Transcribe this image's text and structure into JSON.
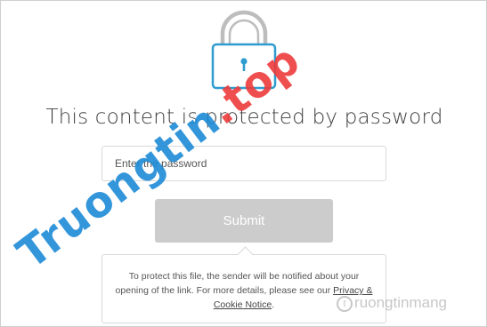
{
  "lock": {
    "icon": "padlock-icon",
    "shackle_color": "#bdbdbd",
    "body_color": "#2f9ccf"
  },
  "heading": "This content is protected by password",
  "password_field": {
    "placeholder": "Enter the password",
    "value": ""
  },
  "submit_label": "Submit",
  "notice": {
    "text": "To protect this file, the sender will be notified about your opening of the link. For more details, please see our ",
    "link_label": "Privacy & Cookie Notice",
    "suffix": "."
  },
  "watermark": {
    "main_prefix": "Truongtin",
    "main_suffix": ".top",
    "secondary_icon_glyph": "t",
    "secondary_text": "ruongtinmang"
  },
  "colors": {
    "accent": "#2f9ccf",
    "button_disabled": "#cccccc",
    "watermark_blue": "#1e8bd6",
    "watermark_red": "#ee3b3b"
  }
}
